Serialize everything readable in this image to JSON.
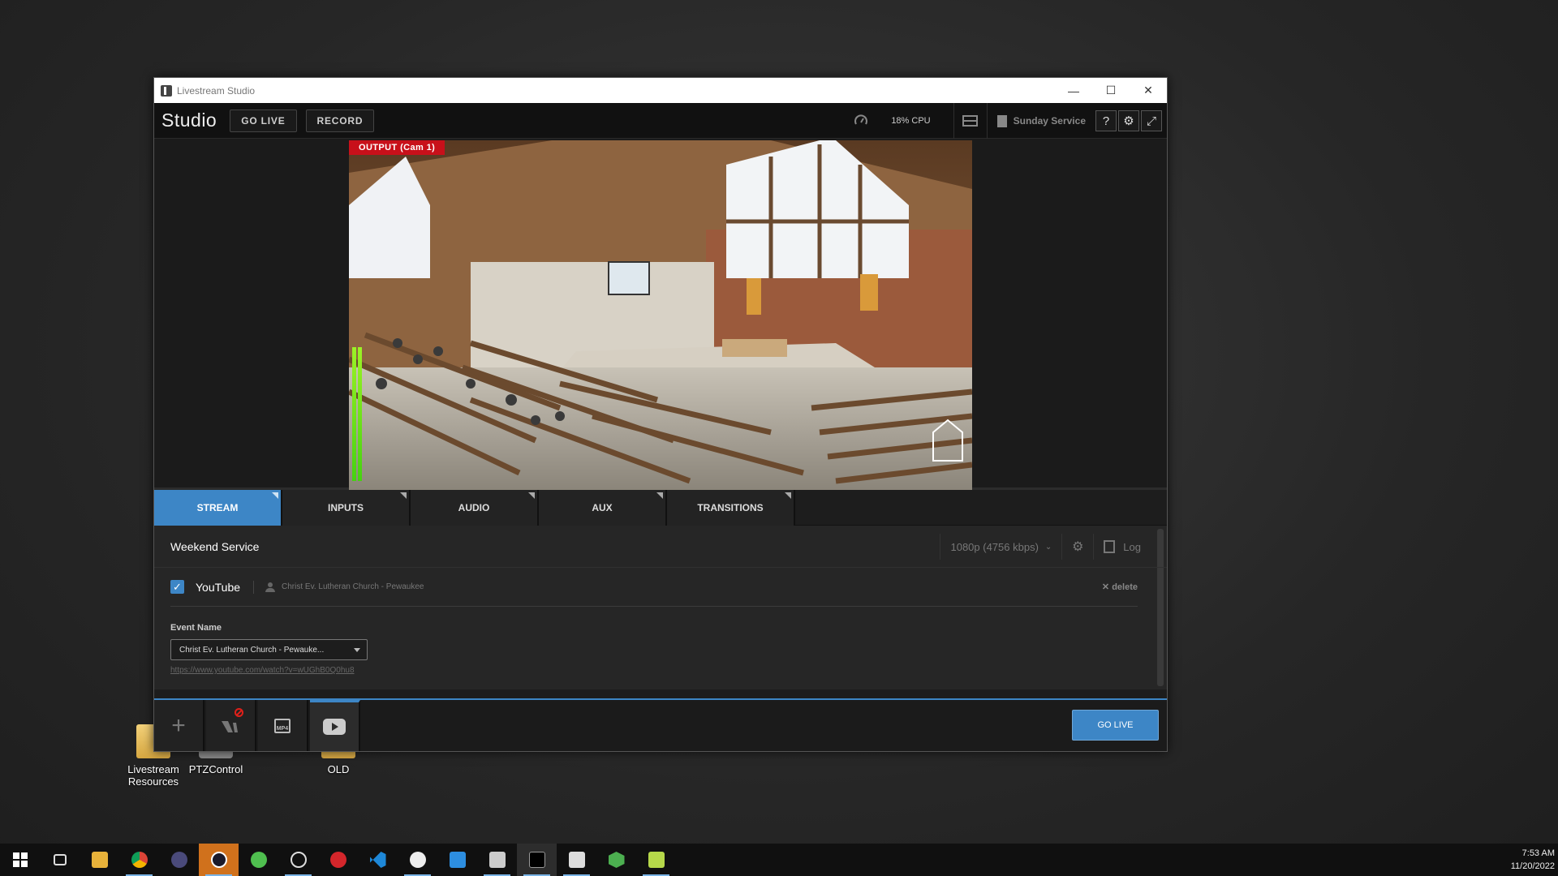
{
  "desktop": {
    "icons": [
      {
        "label": "Livestream\nResources"
      },
      {
        "label": "PTZControl"
      },
      {
        "label": "OLD"
      }
    ]
  },
  "window": {
    "title": "Livestream Studio",
    "controls": {
      "minimize": "—",
      "maximize": "☐",
      "close": "✕"
    }
  },
  "toolbar": {
    "brand": "Studio",
    "go_live": "GO LIVE",
    "record": "RECORD",
    "cpu": "18% CPU",
    "project": "Sunday Service"
  },
  "preview": {
    "output_label": "OUTPUT (Cam 1)"
  },
  "tabs": [
    {
      "label": "STREAM",
      "active": true
    },
    {
      "label": "INPUTS",
      "active": false
    },
    {
      "label": "AUDIO",
      "active": false
    },
    {
      "label": "AUX",
      "active": false
    },
    {
      "label": "TRANSITIONS",
      "active": false
    }
  ],
  "stream": {
    "service_name": "Weekend Service",
    "quality": "1080p (4756 kbps)",
    "log_label": "Log",
    "destination": {
      "checked": true,
      "platform": "YouTube",
      "channel": "Christ Ev. Lutheran Church - Pewaukee",
      "delete_label": "delete"
    },
    "event_name_label": "Event Name",
    "event_name_value": "Christ Ev. Lutheran Church - Pewauke...",
    "event_url": "https://www.youtube.com/watch?v=wUGhB0Q0hu8"
  },
  "bottom": {
    "mp4_label": "MP4",
    "go_live": "GO LIVE"
  },
  "taskbar": {
    "time": "7:53 AM",
    "date": "11/20/2022"
  },
  "colors": {
    "accent": "#3d86c6",
    "output_red": "#c8101a",
    "vu_green": "#5fdc1a"
  }
}
